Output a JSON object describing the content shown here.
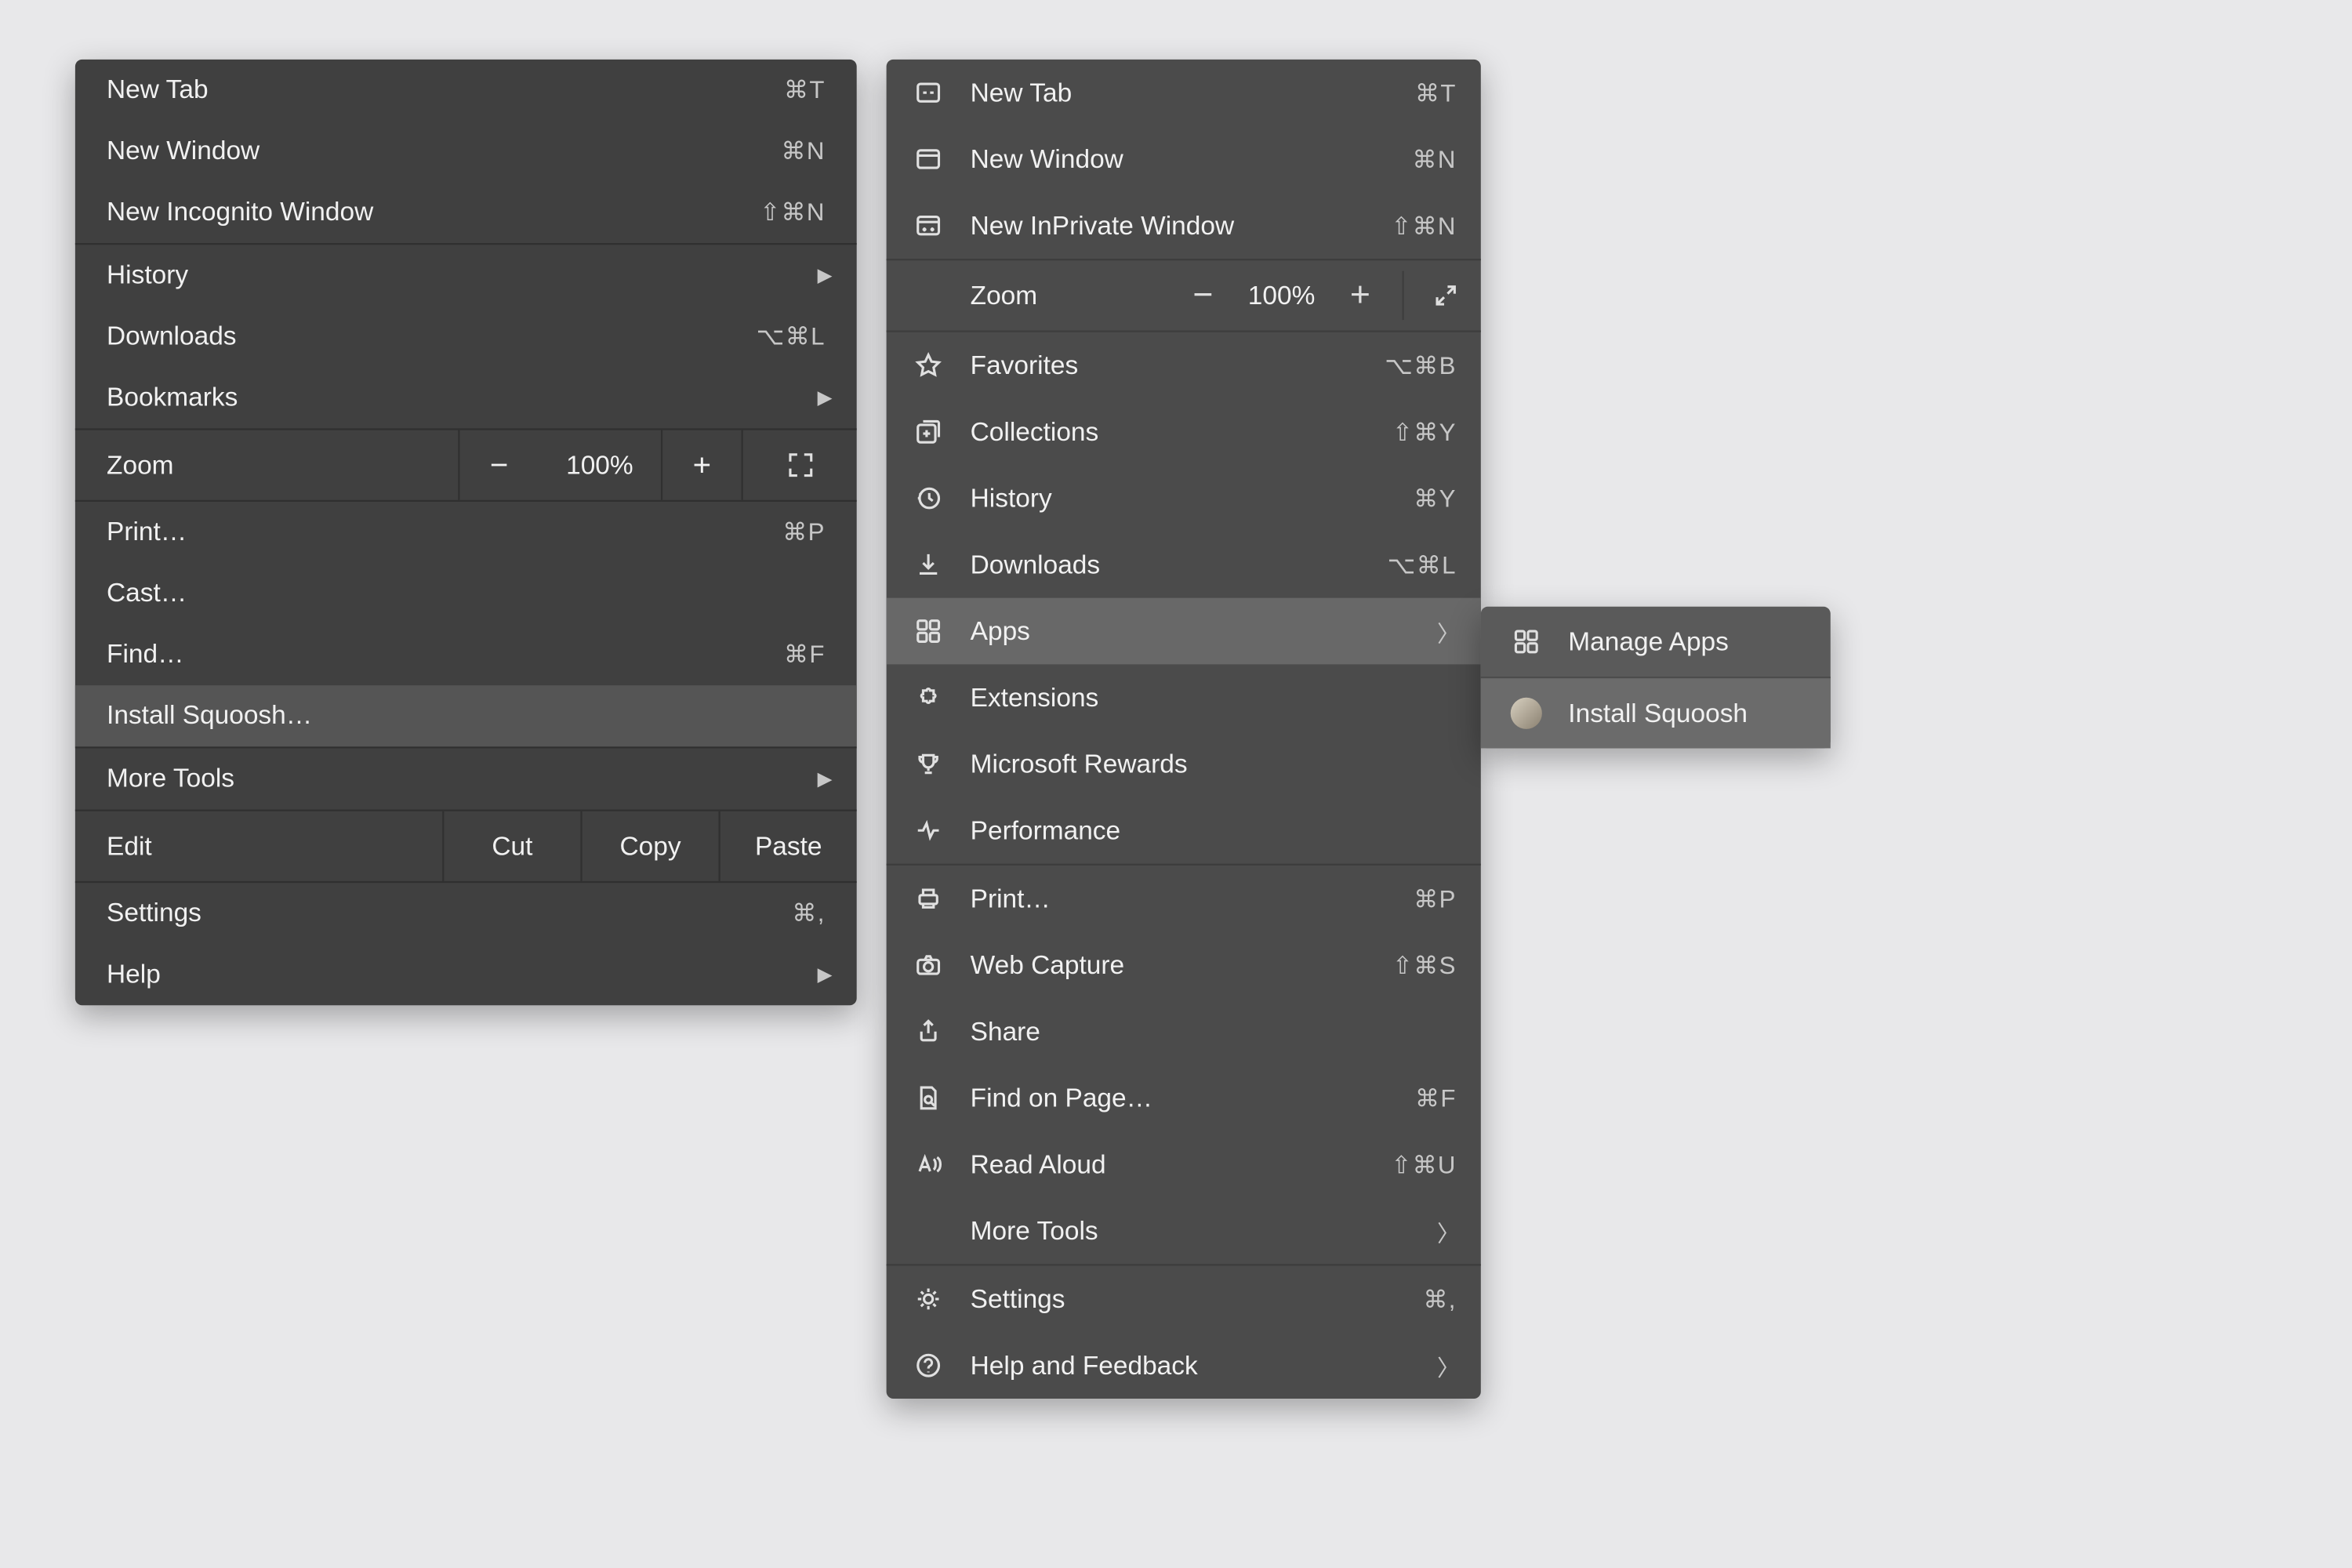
{
  "chrome": {
    "new_tab": "New Tab",
    "new_tab_sc": "⌘T",
    "new_window": "New Window",
    "new_window_sc": "⌘N",
    "incognito": "New Incognito Window",
    "incognito_sc": "⇧⌘N",
    "history": "History",
    "downloads": "Downloads",
    "downloads_sc": "⌥⌘L",
    "bookmarks": "Bookmarks",
    "zoom": "Zoom",
    "zoom_pct": "100%",
    "minus": "−",
    "plus": "+",
    "print": "Print…",
    "print_sc": "⌘P",
    "cast": "Cast…",
    "find": "Find…",
    "find_sc": "⌘F",
    "install": "Install Squoosh…",
    "more_tools": "More Tools",
    "edit": "Edit",
    "cut": "Cut",
    "copy": "Copy",
    "paste": "Paste",
    "settings": "Settings",
    "settings_sc": "⌘,",
    "help": "Help"
  },
  "edge": {
    "new_tab": "New Tab",
    "new_tab_sc": "⌘T",
    "new_window": "New Window",
    "new_window_sc": "⌘N",
    "inprivate": "New InPrivate Window",
    "inprivate_sc": "⇧⌘N",
    "zoom": "Zoom",
    "zoom_pct": "100%",
    "favorites": "Favorites",
    "favorites_sc": "⌥⌘B",
    "collections": "Collections",
    "collections_sc": "⇧⌘Y",
    "history": "History",
    "history_sc": "⌘Y",
    "downloads": "Downloads",
    "downloads_sc": "⌥⌘L",
    "apps": "Apps",
    "extensions": "Extensions",
    "rewards": "Microsoft Rewards",
    "performance": "Performance",
    "print": "Print…",
    "print_sc": "⌘P",
    "webcapture": "Web Capture",
    "webcapture_sc": "⇧⌘S",
    "share": "Share",
    "find": "Find on Page…",
    "find_sc": "⌘F",
    "read_aloud": "Read Aloud",
    "read_aloud_sc": "⇧⌘U",
    "more_tools": "More Tools",
    "settings": "Settings",
    "settings_sc": "⌘,",
    "help": "Help and Feedback"
  },
  "submenu": {
    "manage": "Manage Apps",
    "install": "Install Squoosh"
  }
}
